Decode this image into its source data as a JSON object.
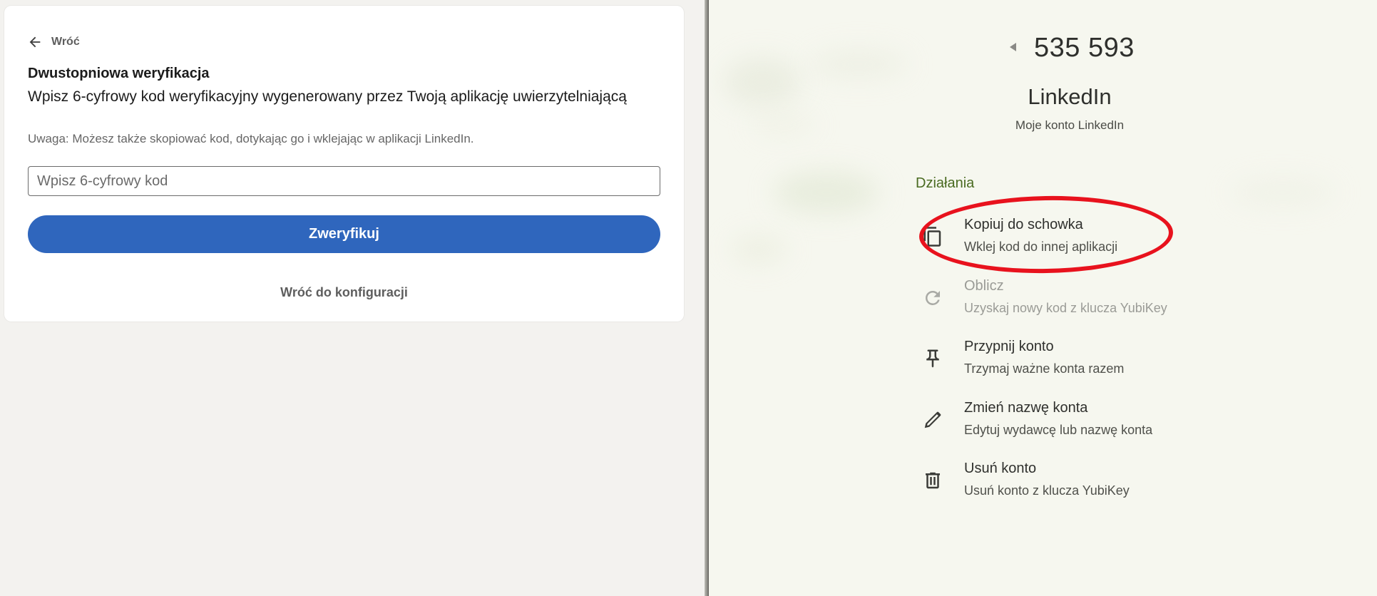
{
  "linkedin": {
    "back_label": "Wróć",
    "title": "Dwustopniowa weryfikacja",
    "subtitle": "Wpisz 6-cyfrowy kod weryfikacyjny wygenerowany przez Twoją aplikację uwierzytelniającą",
    "note": "Uwaga: Możesz także skopiować kod, dotykając go i wklejając w aplikacji LinkedIn.",
    "code_input": {
      "value": "",
      "placeholder": "Wpisz 6-cyfrowy kod"
    },
    "verify_button": "Zweryfikuj",
    "back_to_config": "Wróć do konfiguracji",
    "colors": {
      "primary": "#2f66bd",
      "card_bg": "#ffffff",
      "page_bg": "#f3f2ef"
    }
  },
  "authenticator": {
    "code": "535 593",
    "account_name": "LinkedIn",
    "account_sub": "Moje konto LinkedIn",
    "section_header": "Działania",
    "actions": [
      {
        "icon": "copy-icon",
        "title": "Kopiuj do schowka",
        "subtitle": "Wklej kod do innej aplikacji",
        "enabled": true,
        "highlighted": true
      },
      {
        "icon": "refresh-icon",
        "title": "Oblicz",
        "subtitle": "Uzyskaj nowy kod z klucza YubiKey",
        "enabled": false
      },
      {
        "icon": "pin-icon",
        "title": "Przypnij konto",
        "subtitle": "Trzymaj ważne konta razem",
        "enabled": true
      },
      {
        "icon": "pencil-icon",
        "title": "Zmień nazwę konta",
        "subtitle": "Edytuj wydawcę lub nazwę konta",
        "enabled": true
      },
      {
        "icon": "trash-icon",
        "title": "Usuń konto",
        "subtitle": "Usuń konto z klucza YubiKey",
        "enabled": true
      }
    ],
    "colors": {
      "background": "#f6f7ef",
      "section_header": "#4a6b21",
      "highlight": "#e8121d"
    }
  }
}
